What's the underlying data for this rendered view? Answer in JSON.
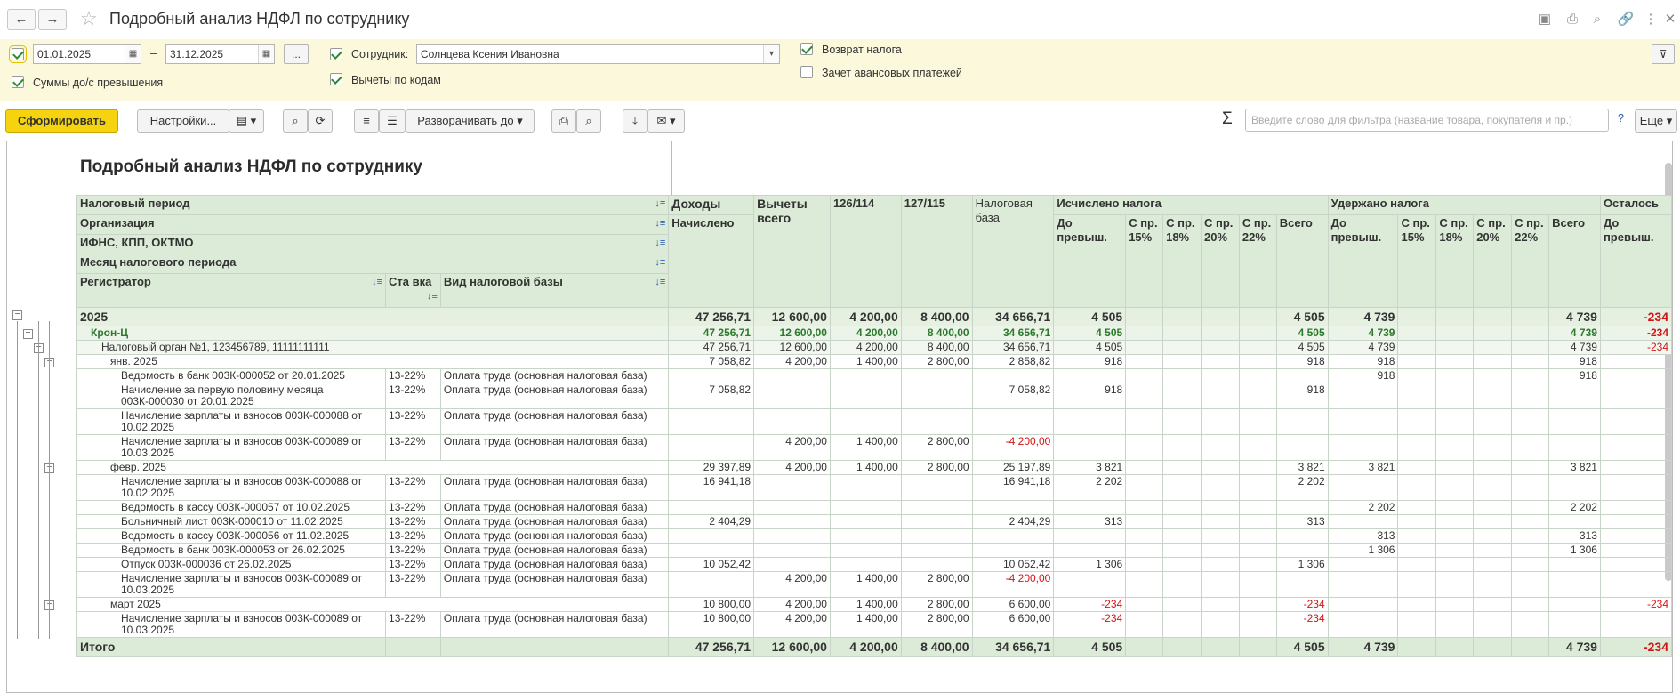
{
  "window": {
    "title": "Подробный анализ НДФЛ по сотруднику",
    "back_icon": "arrow-left-icon",
    "forward_icon": "arrow-right-icon"
  },
  "params": {
    "period_enabled": true,
    "date_from": "01.01.2025",
    "date_sep": "–",
    "date_to": "31.12.2025",
    "more_btn": "...",
    "employee_label": "Сотрудник:",
    "employee_value": "Солнцева Ксения Ивановна",
    "return_tax_label": "Возврат налога",
    "return_tax_checked": true,
    "advance_label": "Зачет авансовых платежей",
    "advance_checked": false,
    "sums_label": "Суммы до/с превышения",
    "sums_checked": true,
    "deductions_label": "Вычеты по кодам",
    "deductions_checked": true
  },
  "toolbar": {
    "generate": "Сформировать",
    "settings": "Настройки...",
    "expand_to": "Разворачивать до",
    "sigma": "Σ",
    "filter_placeholder": "Введите слово для фильтра (название товара, покупателя и пр.)",
    "help": "?",
    "more": "Еще"
  },
  "report": {
    "title": "Подробный анализ НДФЛ по сотруднику",
    "group_headers": [
      "Налоговый период",
      "Организация",
      "ИФНС, КПП, ОКТМО",
      "Месяц налогового периода",
      "Регистратор"
    ],
    "rate_header": "Ста вка",
    "base_type_header": "Вид налоговой базы",
    "col": {
      "income": "Доходы",
      "income_sub": "Начислено",
      "deductions": "Вычеты всего",
      "d126": "126/114",
      "d127": "127/115",
      "base": "Налоговая база",
      "calc": "Исчислено налога",
      "withheld": "Удержано налога",
      "remain": "Осталось",
      "before": "До превыш.",
      "p15": "С пр. 15%",
      "p18": "С пр. 18%",
      "p20": "С пр. 20%",
      "p22": "С пр. 22%",
      "total": "Всего"
    },
    "rows": [
      {
        "kind": "year",
        "label": "2025",
        "rate": "",
        "basetype": "",
        "income": "47 256,71",
        "ded": "12 600,00",
        "d126": "4 200,00",
        "d127": "8 400,00",
        "base": "34 656,71",
        "c_before": "4 505",
        "c_total": "4 505",
        "w_before": "4 739",
        "w_total": "4 739",
        "remain": "-234"
      },
      {
        "kind": "org",
        "label": "Крон-Ц",
        "rate": "",
        "basetype": "",
        "income": "47 256,71",
        "ded": "12 600,00",
        "d126": "4 200,00",
        "d127": "8 400,00",
        "base": "34 656,71",
        "c_before": "4 505",
        "c_total": "4 505",
        "w_before": "4 739",
        "w_total": "4 739",
        "remain": "-234"
      },
      {
        "kind": "tax",
        "label": "Налоговый орган №1, 123456789, 11111111111",
        "rate": "",
        "basetype": "",
        "income": "47 256,71",
        "ded": "12 600,00",
        "d126": "4 200,00",
        "d127": "8 400,00",
        "base": "34 656,71",
        "c_before": "4 505",
        "c_total": "4 505",
        "w_before": "4 739",
        "w_total": "4 739",
        "remain": "-234"
      },
      {
        "kind": "month",
        "label": "янв. 2025",
        "rate": "",
        "basetype": "",
        "income": "7 058,82",
        "ded": "4 200,00",
        "d126": "1 400,00",
        "d127": "2 800,00",
        "base": "2 858,82",
        "c_before": "918",
        "c_total": "918",
        "w_before": "918",
        "w_total": "918",
        "remain": ""
      },
      {
        "kind": "doc",
        "label": "Ведомость в банк 003К-000052 от 20.01.2025",
        "rate": "13-22%",
        "basetype": "Оплата труда (основная налоговая база)",
        "income": "",
        "ded": "",
        "d126": "",
        "d127": "",
        "base": "",
        "c_before": "",
        "c_total": "",
        "w_before": "918",
        "w_total": "918",
        "remain": ""
      },
      {
        "kind": "doc2",
        "label": "Начисление за первую половину месяца 003К-000030 от 20.01.2025",
        "rate": "13-22%",
        "basetype": "Оплата труда (основная налоговая база)",
        "income": "7 058,82",
        "ded": "",
        "d126": "",
        "d127": "",
        "base": "7 058,82",
        "c_before": "918",
        "c_total": "918",
        "w_before": "",
        "w_total": "",
        "remain": ""
      },
      {
        "kind": "doc2",
        "label": "Начисление зарплаты и взносов 003К-000088 от 10.02.2025",
        "rate": "13-22%",
        "basetype": "Оплата труда (основная налоговая база)",
        "income": "",
        "ded": "",
        "d126": "",
        "d127": "",
        "base": "",
        "c_before": "",
        "c_total": "",
        "w_before": "",
        "w_total": "",
        "remain": ""
      },
      {
        "kind": "doc2",
        "label": "Начисление зарплаты и взносов 003К-000089 от 10.03.2025",
        "rate": "13-22%",
        "basetype": "Оплата труда (основная налоговая база)",
        "income": "",
        "ded": "4 200,00",
        "d126": "1 400,00",
        "d127": "2 800,00",
        "base": "-4 200,00",
        "c_before": "",
        "c_total": "",
        "w_before": "",
        "w_total": "",
        "remain": ""
      },
      {
        "kind": "month",
        "label": "февр. 2025",
        "rate": "",
        "basetype": "",
        "income": "29 397,89",
        "ded": "4 200,00",
        "d126": "1 400,00",
        "d127": "2 800,00",
        "base": "25 197,89",
        "c_before": "3 821",
        "c_total": "3 821",
        "w_before": "3 821",
        "w_total": "3 821",
        "remain": ""
      },
      {
        "kind": "doc2",
        "label": "Начисление зарплаты и взносов 003К-000088 от 10.02.2025",
        "rate": "13-22%",
        "basetype": "Оплата труда (основная налоговая база)",
        "income": "16 941,18",
        "ded": "",
        "d126": "",
        "d127": "",
        "base": "16 941,18",
        "c_before": "2 202",
        "c_total": "2 202",
        "w_before": "",
        "w_total": "",
        "remain": ""
      },
      {
        "kind": "doc",
        "label": "Ведомость в кассу 003К-000057 от 10.02.2025",
        "rate": "13-22%",
        "basetype": "Оплата труда (основная налоговая база)",
        "income": "",
        "ded": "",
        "d126": "",
        "d127": "",
        "base": "",
        "c_before": "",
        "c_total": "",
        "w_before": "2 202",
        "w_total": "2 202",
        "remain": ""
      },
      {
        "kind": "doc",
        "label": "Больничный лист 003К-000010 от 11.02.2025",
        "rate": "13-22%",
        "basetype": "Оплата труда (основная налоговая база)",
        "income": "2 404,29",
        "ded": "",
        "d126": "",
        "d127": "",
        "base": "2 404,29",
        "c_before": "313",
        "c_total": "313",
        "w_before": "",
        "w_total": "",
        "remain": ""
      },
      {
        "kind": "doc",
        "label": "Ведомость в кассу 003К-000056 от 11.02.2025",
        "rate": "13-22%",
        "basetype": "Оплата труда (основная налоговая база)",
        "income": "",
        "ded": "",
        "d126": "",
        "d127": "",
        "base": "",
        "c_before": "",
        "c_total": "",
        "w_before": "313",
        "w_total": "313",
        "remain": ""
      },
      {
        "kind": "doc",
        "label": "Ведомость в банк 003К-000053 от 26.02.2025",
        "rate": "13-22%",
        "basetype": "Оплата труда (основная налоговая база)",
        "income": "",
        "ded": "",
        "d126": "",
        "d127": "",
        "base": "",
        "c_before": "",
        "c_total": "",
        "w_before": "1 306",
        "w_total": "1 306",
        "remain": ""
      },
      {
        "kind": "doc",
        "label": "Отпуск 003К-000036 от 26.02.2025",
        "rate": "13-22%",
        "basetype": "Оплата труда (основная налоговая база)",
        "income": "10 052,42",
        "ded": "",
        "d126": "",
        "d127": "",
        "base": "10 052,42",
        "c_before": "1 306",
        "c_total": "1 306",
        "w_before": "",
        "w_total": "",
        "remain": ""
      },
      {
        "kind": "doc2",
        "label": "Начисление зарплаты и взносов 003К-000089 от 10.03.2025",
        "rate": "13-22%",
        "basetype": "Оплата труда (основная налоговая база)",
        "income": "",
        "ded": "4 200,00",
        "d126": "1 400,00",
        "d127": "2 800,00",
        "base": "-4 200,00",
        "c_before": "",
        "c_total": "",
        "w_before": "",
        "w_total": "",
        "remain": ""
      },
      {
        "kind": "month",
        "label": "март 2025",
        "rate": "",
        "basetype": "",
        "income": "10 800,00",
        "ded": "4 200,00",
        "d126": "1 400,00",
        "d127": "2 800,00",
        "base": "6 600,00",
        "c_before": "-234",
        "c_total": "-234",
        "w_before": "",
        "w_total": "",
        "remain": "-234"
      },
      {
        "kind": "doc2",
        "label": "Начисление зарплаты и взносов 003К-000089 от 10.03.2025",
        "rate": "13-22%",
        "basetype": "Оплата труда (основная налоговая база)",
        "income": "10 800,00",
        "ded": "4 200,00",
        "d126": "1 400,00",
        "d127": "2 800,00",
        "base": "6 600,00",
        "c_before": "-234",
        "c_total": "-234",
        "w_before": "",
        "w_total": "",
        "remain": ""
      },
      {
        "kind": "total",
        "label": "Итого",
        "rate": "",
        "basetype": "",
        "income": "47 256,71",
        "ded": "12 600,00",
        "d126": "4 200,00",
        "d127": "8 400,00",
        "base": "34 656,71",
        "c_before": "4 505",
        "c_total": "4 505",
        "w_before": "4 739",
        "w_total": "4 739",
        "remain": "-234"
      }
    ]
  }
}
